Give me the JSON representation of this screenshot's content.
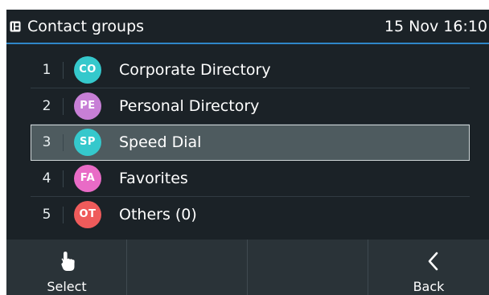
{
  "header": {
    "title": "Contact groups",
    "datetime": "15 Nov 16:10",
    "accent_color": "#2f86c8"
  },
  "groups": [
    {
      "index": "1",
      "initials": "CO",
      "name": "Corporate Directory",
      "color": "#35c8cc",
      "selected": false
    },
    {
      "index": "2",
      "initials": "PE",
      "name": "Personal Directory",
      "color": "#c77fd6",
      "selected": false
    },
    {
      "index": "3",
      "initials": "SP",
      "name": "Speed Dial",
      "color": "#35c8cc",
      "selected": true
    },
    {
      "index": "4",
      "initials": "FA",
      "name": "Favorites",
      "color": "#e96bc6",
      "selected": false
    },
    {
      "index": "5",
      "initials": "OT",
      "name": "Others (0)",
      "color": "#ef5b5b",
      "selected": false
    }
  ],
  "softkeys": [
    {
      "label": "Select",
      "icon": "hand-pointer-icon"
    },
    {
      "label": "",
      "icon": ""
    },
    {
      "label": "",
      "icon": ""
    },
    {
      "label": "Back",
      "icon": "chevron-left-icon"
    }
  ]
}
